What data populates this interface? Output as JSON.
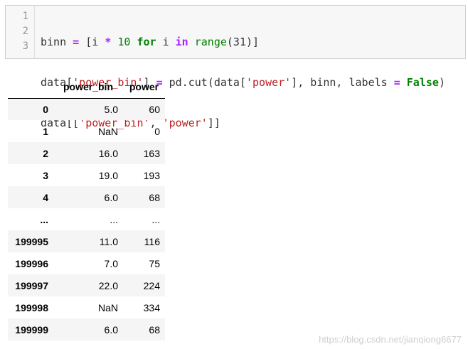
{
  "code_cell": {
    "line_numbers": [
      "1",
      "2",
      "3"
    ],
    "line1": {
      "var": "binn ",
      "eq": "=",
      "open": " [i ",
      "mul": "*",
      "num": " 10 ",
      "for": "for",
      "mid": " i ",
      "in": "in",
      "sp": " ",
      "range": "range",
      "args": "(31)]"
    },
    "line2": {
      "a": "data[",
      "s1": "'power_bin'",
      "b": "] ",
      "eq": "=",
      "c": " pd.cut(data[",
      "s2": "'power'",
      "d": "], binn, labels ",
      "eq2": "=",
      "sp": " ",
      "false": "False",
      "e": ")"
    },
    "line3": {
      "a": "data[[",
      "s1": "'power_bin'",
      "b": ", ",
      "s2": "'power'",
      "c": "]]"
    }
  },
  "table": {
    "columns": [
      "",
      "power_bin",
      "power"
    ],
    "rows": [
      {
        "index": "0",
        "power_bin": "5.0",
        "power": "60"
      },
      {
        "index": "1",
        "power_bin": "NaN",
        "power": "0"
      },
      {
        "index": "2",
        "power_bin": "16.0",
        "power": "163"
      },
      {
        "index": "3",
        "power_bin": "19.0",
        "power": "193"
      },
      {
        "index": "4",
        "power_bin": "6.0",
        "power": "68"
      },
      {
        "index": "...",
        "power_bin": "...",
        "power": "..."
      },
      {
        "index": "199995",
        "power_bin": "11.0",
        "power": "116"
      },
      {
        "index": "199996",
        "power_bin": "7.0",
        "power": "75"
      },
      {
        "index": "199997",
        "power_bin": "22.0",
        "power": "224"
      },
      {
        "index": "199998",
        "power_bin": "NaN",
        "power": "334"
      },
      {
        "index": "199999",
        "power_bin": "6.0",
        "power": "68"
      }
    ]
  },
  "watermark": "https://blog.csdn.net/jianqiong6677"
}
